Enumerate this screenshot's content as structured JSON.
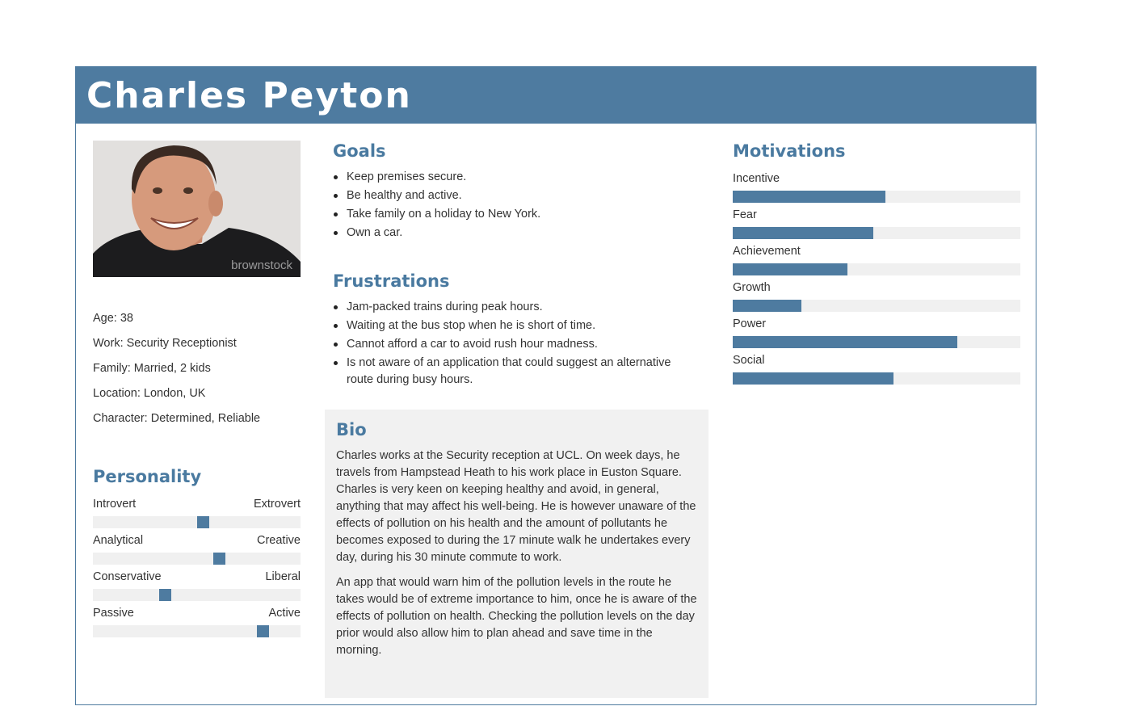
{
  "persona": {
    "name": "Charles Peyton",
    "photo_watermark": "brownstock",
    "facts": [
      "Age: 38",
      "Work: Security Receptionist",
      "Family: Married, 2 kids",
      "Location: London, UK",
      "Character: Determined, Reliable"
    ]
  },
  "personality": {
    "title": "Personality",
    "traits": [
      {
        "left": "Introvert",
        "right": "Extrovert",
        "value": 0.53
      },
      {
        "left": "Analytical",
        "right": "Creative",
        "value": 0.61
      },
      {
        "left": "Conservative",
        "right": "Liberal",
        "value": 0.35
      },
      {
        "left": "Passive",
        "right": "Active",
        "value": 0.82
      }
    ]
  },
  "goals": {
    "title": "Goals",
    "items": [
      "Keep premises secure.",
      "Be healthy and active.",
      "Take family on a holiday to New York.",
      "Own a car."
    ]
  },
  "frustrations": {
    "title": "Frustrations",
    "items": [
      "Jam-packed trains during peak hours.",
      "Waiting at the bus stop when he is short of time.",
      "Cannot afford a car to avoid rush hour madness.",
      "Is not aware of an application that could suggest an alternative route during busy hours."
    ]
  },
  "bio": {
    "title": "Bio",
    "paragraphs": [
      "Charles works at the Security reception at UCL. On week days, he travels from Hampstead Heath to his work place in Euston Square. Charles is very keen on keeping healthy and avoid, in general, anything that may affect his well-being. He is however unaware of the effects of pollution on his health and the amount of pollutants he becomes exposed to during the 17 minute walk he undertakes every day, during his 30 minute commute to work.",
      "An app that would warn him of the pollution levels in the route he takes would be of extreme importance to him, once he is aware of the effects of pollution on health. Checking the pollution levels on the day prior would also allow him to plan ahead and save time in the morning."
    ]
  },
  "motivations": {
    "title": "Motivations",
    "items": [
      {
        "label": "Incentive",
        "value": 0.53
      },
      {
        "label": "Fear",
        "value": 0.49
      },
      {
        "label": "Achievement",
        "value": 0.4
      },
      {
        "label": "Growth",
        "value": 0.24
      },
      {
        "label": "Power",
        "value": 0.78
      },
      {
        "label": "Social",
        "value": 0.56
      }
    ]
  },
  "colors": {
    "accent": "#4e7ba0",
    "track": "#f0f0f0",
    "bio_background": "#f1f1f1"
  }
}
